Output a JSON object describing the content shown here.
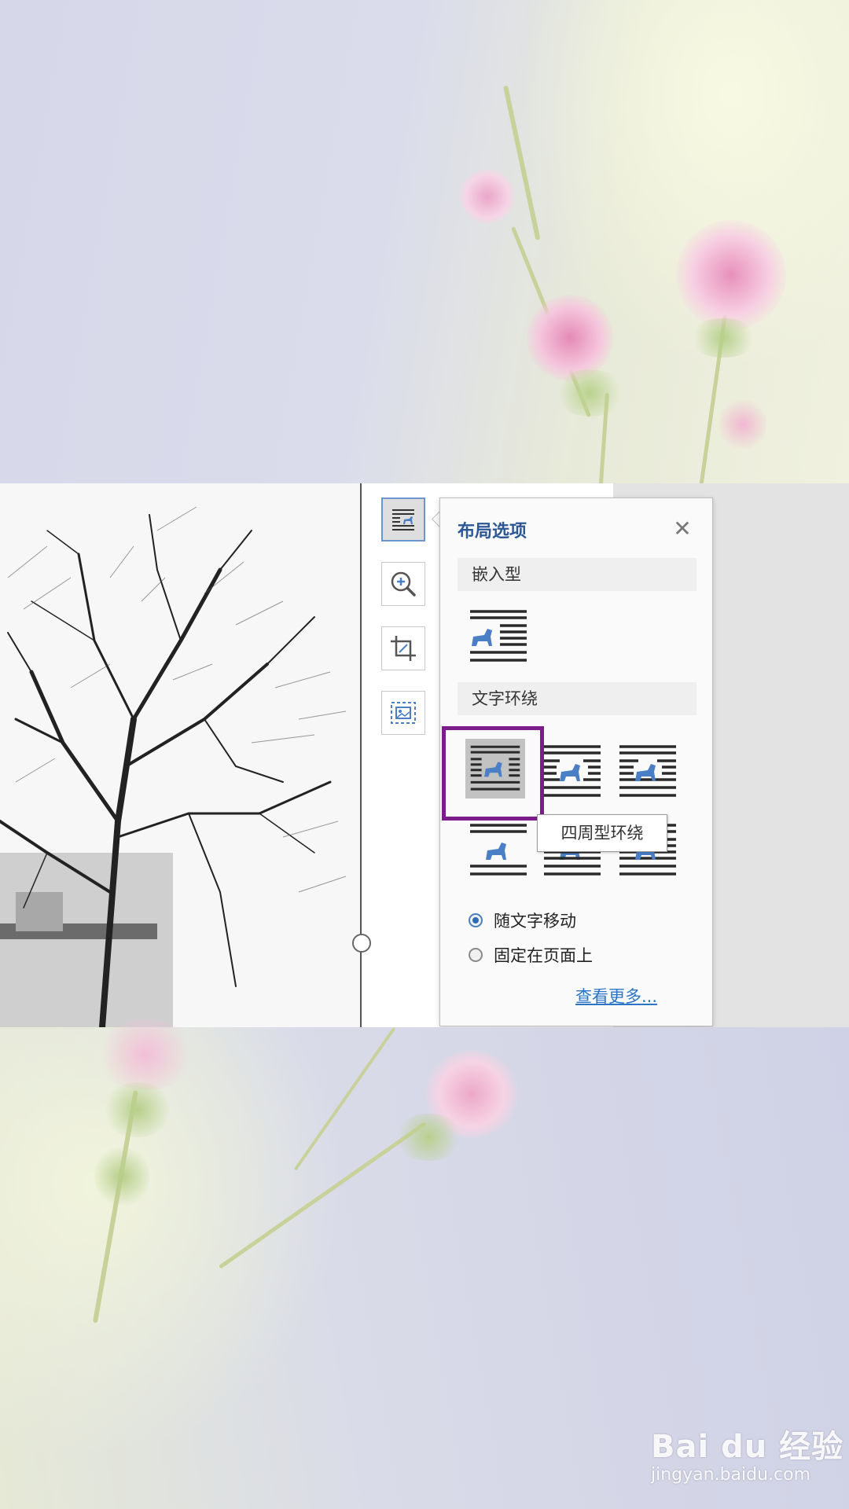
{
  "layout_panel": {
    "title": "布局选项",
    "inline_section": "嵌入型",
    "wrap_section": "文字环绕",
    "tooltip": "四周型环绕",
    "radio_move_with_text": "随文字移动",
    "radio_fix_on_page": "固定在页面上",
    "see_more": "查看更多..."
  },
  "watermark": {
    "logo": "Bai du 经验",
    "url": "jingyan.baidu.com"
  },
  "colors": {
    "panel_title": "#2b5797",
    "highlight_box": "#7a1d8a",
    "link": "#2a74c9",
    "horse_icon": "#4a7fc6"
  }
}
